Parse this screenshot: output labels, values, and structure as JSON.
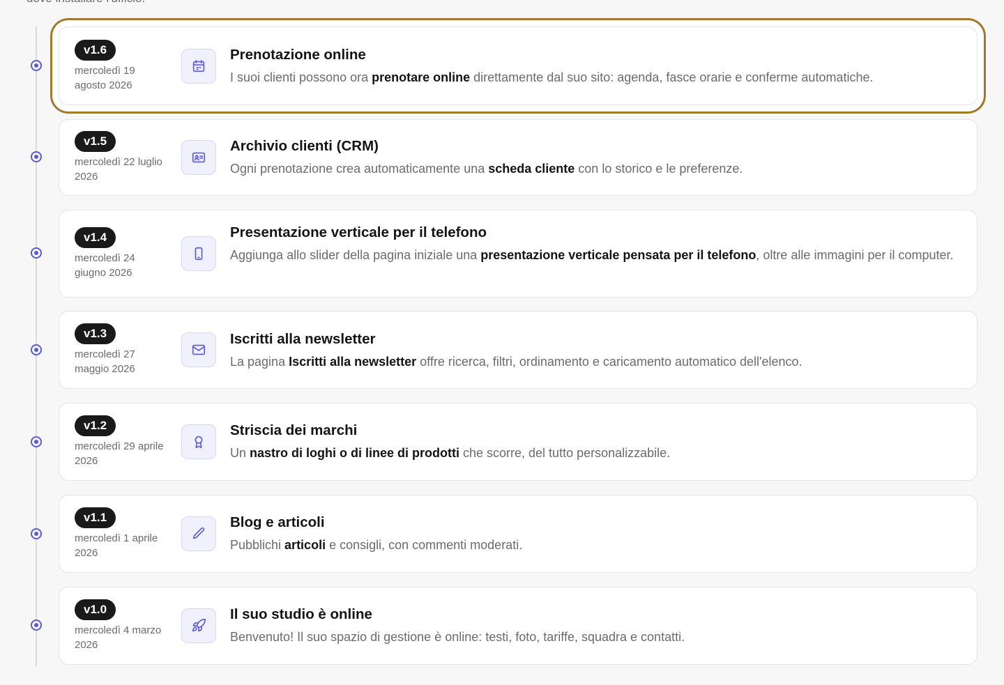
{
  "header": {
    "intro_fragment": "dove installare l'ufficio."
  },
  "colors": {
    "accent": "#5b5bd6",
    "highlight": "#a07a2c",
    "badge": "#1a1a1a"
  },
  "releases": [
    {
      "version": "v1.6",
      "date": "mercoledì 19 agosto 2026",
      "icon": "calendar-icon",
      "title": "Prenotazione online",
      "desc_before": "I suoi clienti possono ora ",
      "desc_bold": "prenotare online",
      "desc_after": " direttamente dal suo sito: agenda, fasce orarie e conferme automatiche."
    },
    {
      "version": "v1.5",
      "date": "mercoledì 22 luglio 2026",
      "icon": "contact-card-icon",
      "title": "Archivio clienti (CRM)",
      "desc_before": "Ogni prenotazione crea automaticamente una ",
      "desc_bold": "scheda cliente",
      "desc_after": " con lo storico e le preferenze."
    },
    {
      "version": "v1.4",
      "date": "mercoledì 24 giugno 2026",
      "icon": "smartphone-icon",
      "title": "Presentazione verticale per il telefono",
      "desc_before": "Aggiunga allo slider della pagina iniziale una ",
      "desc_bold": "presentazione verticale pensata per il telefono",
      "desc_after": ", oltre alle immagini per il computer."
    },
    {
      "version": "v1.3",
      "date": "mercoledì 27 maggio 2026",
      "icon": "mail-icon",
      "title": "Iscritti alla newsletter",
      "desc_before": "La pagina ",
      "desc_bold": "Iscritti alla newsletter",
      "desc_after": " offre ricerca, filtri, ordinamento e caricamento automatico dell'elenco."
    },
    {
      "version": "v1.2",
      "date": "mercoledì 29 aprile 2026",
      "icon": "award-icon",
      "title": "Striscia dei marchi",
      "desc_before": "Un ",
      "desc_bold": "nastro di loghi o di linee di prodotti",
      "desc_after": " che scorre, del tutto personalizzabile."
    },
    {
      "version": "v1.1",
      "date": "mercoledì 1 aprile 2026",
      "icon": "pencil-icon",
      "title": "Blog e articoli",
      "desc_before": "Pubblichi ",
      "desc_bold": "articoli",
      "desc_after": " e consigli, con commenti moderati."
    },
    {
      "version": "v1.0",
      "date": "mercoledì 4 marzo 2026",
      "icon": "rocket-icon",
      "title": "Il suo studio è online",
      "desc_before": "Benvenuto! Il suo spazio di gestione è online: testi, foto, tariffe, squadra e contatti.",
      "desc_bold": "",
      "desc_after": ""
    }
  ]
}
